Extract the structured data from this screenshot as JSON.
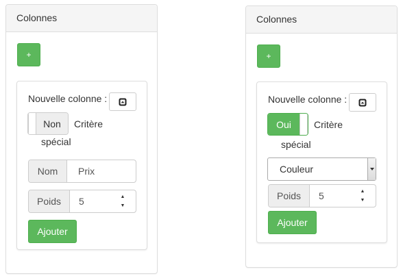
{
  "left_panel": {
    "title": "Colonnes",
    "add_button_label": "+",
    "new_column_label": "Nouvelle colonne :",
    "toggle_state": "Non",
    "toggle_label_line1": "Critère",
    "toggle_label_line2": "spécial",
    "name_addon": "Nom",
    "name_value": "Prix",
    "weight_addon": "Poids",
    "weight_value": "5",
    "submit_label": "Ajouter"
  },
  "right_panel": {
    "title": "Colonnes",
    "add_button_label": "+",
    "new_column_label": "Nouvelle colonne :",
    "toggle_state": "Oui",
    "toggle_label_line1": "Critère",
    "toggle_label_line2": "spécial",
    "select_value": "Couleur",
    "weight_addon": "Poids",
    "weight_value": "5",
    "submit_label": "Ajouter"
  },
  "icons": {
    "collapse": "collapse-icon",
    "spinner_up": "spinner-up-icon",
    "spinner_down": "spinner-down-icon",
    "dropdown": "dropdown-caret-icon"
  },
  "colors": {
    "success": "#5cb85c",
    "panel_heading_bg": "#f5f5f5",
    "border": "#dddddd",
    "addon_bg": "#eeeeee"
  }
}
